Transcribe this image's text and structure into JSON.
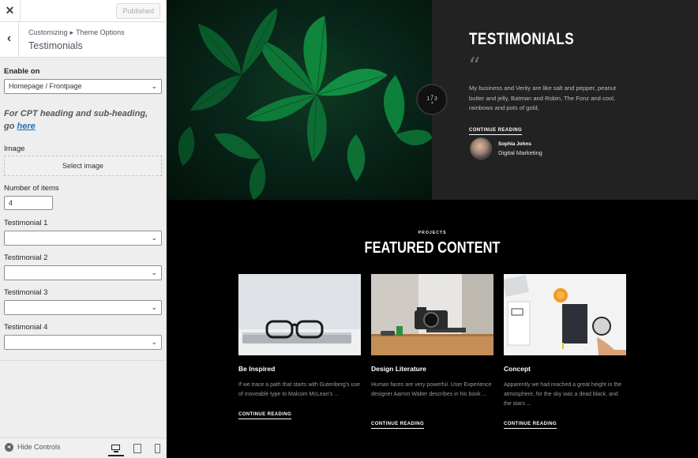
{
  "sidebar": {
    "close_icon": "close-icon",
    "published_label": "Published",
    "breadcrumb_root": "Customizing",
    "breadcrumb_separator": "▸",
    "breadcrumb_parent": "Theme Options",
    "section_title": "Testimonials",
    "enable_on_label": "Enable on",
    "enable_on_value": "Homepage / Frontpage",
    "cpt_note_text": "For CPT heading and sub-heading, go",
    "cpt_note_link": "here",
    "image_label": "Image",
    "select_image_label": "Select image",
    "number_label": "Number of items",
    "number_value": "4",
    "testimonials": [
      {
        "label": "Testimonial 1",
        "value": ""
      },
      {
        "label": "Testimonial 2",
        "value": ""
      },
      {
        "label": "Testimonial 3",
        "value": ""
      },
      {
        "label": "Testimonial 4",
        "value": ""
      }
    ],
    "hide_controls_label": "Hide Controls",
    "devices": [
      "desktop-icon",
      "tablet-icon",
      "mobile-icon"
    ]
  },
  "preview": {
    "testimonials_title": "TESTIMONIALS",
    "quote_text": "My business and Verity are like salt and pepper, peanut butter and jelly, Batman and Robin, The Fonz and cool, rainbows and pots of gold,",
    "continue_label": "CONTINUE READING",
    "author_name": "Sophia Johns",
    "author_role": "Digital Marketing",
    "slider_count": "1 / 3",
    "projects_eyebrow": "PROJECTS",
    "featured_title": "FEATURED CONTENT",
    "cards": [
      {
        "title": "Be Inspired",
        "excerpt": "If we trace a path that starts with Gutenberg's use of moveable type to Malcom McLean's ...",
        "continue": "CONTINUE READING"
      },
      {
        "title": "Design Literature",
        "excerpt": "Human faces are very powerful. User Experience designer Aarron Walter describes in his book ...",
        "continue": "CONTINUE READING"
      },
      {
        "title": "Concept",
        "excerpt": "Apparently we had reached a great height in the atmosphere, for the sky was a dead black, and the stars ...",
        "continue": "CONTINUE READING"
      }
    ]
  },
  "colors": {
    "link": "#2271b1",
    "testimonial_panel": "#222222",
    "page_background": "#000000"
  }
}
